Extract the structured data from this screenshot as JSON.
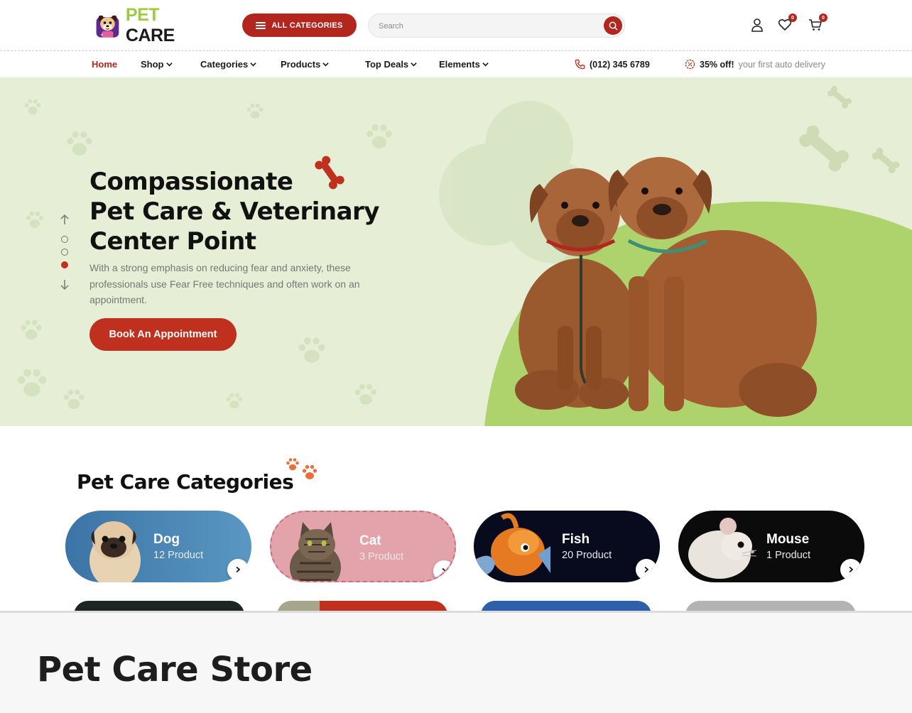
{
  "brand": {
    "name_part1": "PET",
    "name_part2": "CARE"
  },
  "header": {
    "all_categories_label": "ALL CATEGORIES",
    "search_placeholder": "Search",
    "wishlist_count": "0",
    "cart_count": "0"
  },
  "nav": {
    "items": [
      {
        "label": "Home",
        "active": true
      },
      {
        "label": "Shop"
      },
      {
        "label": "Categories"
      },
      {
        "label": "Products"
      },
      {
        "label": "Top Deals"
      },
      {
        "label": "Elements"
      }
    ],
    "phone": "(012) 345 6789",
    "promo_bold": "35% off!",
    "promo_rest": "your first auto delivery"
  },
  "hero": {
    "title_lines": [
      "Compassionate",
      "Pet Care & Veterinary",
      "Center Point"
    ],
    "description": "With a strong emphasis on reducing fear and anxiety, these professionals use Fear Free techniques and often work on an appointment.",
    "cta_label": "Book An Appointment",
    "active_slide": 3,
    "slide_count": 3
  },
  "categories": {
    "title": "Pet Care Categories",
    "cards": [
      {
        "name": "Dog",
        "count": "12 Product"
      },
      {
        "name": "Cat",
        "count": "3 Product"
      },
      {
        "name": "Fish",
        "count": "20 Product"
      },
      {
        "name": "Mouse",
        "count": "1 Product"
      }
    ]
  },
  "caption": {
    "title": "Pet Care Store"
  },
  "colors": {
    "accent": "#b3261e",
    "brand_green": "#9ccc3c",
    "hero_bg": "#e6efd5",
    "hero_shape": "#aed36c"
  },
  "icons": [
    "hamburger-icon",
    "search-icon",
    "user-icon",
    "heart-icon",
    "cart-icon",
    "phone-icon",
    "discount-icon",
    "chevron-down-icon",
    "arrow-up-icon",
    "arrow-down-icon",
    "chevron-right-icon",
    "bone-icon",
    "paw-icon"
  ]
}
